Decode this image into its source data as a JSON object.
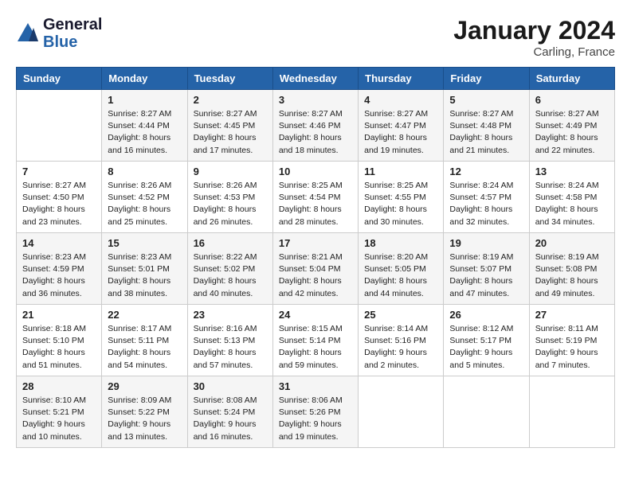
{
  "logo": {
    "line1": "General",
    "line2": "Blue"
  },
  "header": {
    "month": "January 2024",
    "location": "Carling, France"
  },
  "weekdays": [
    "Sunday",
    "Monday",
    "Tuesday",
    "Wednesday",
    "Thursday",
    "Friday",
    "Saturday"
  ],
  "weeks": [
    [
      {
        "day": "",
        "sunrise": "",
        "sunset": "",
        "daylight": ""
      },
      {
        "day": "1",
        "sunrise": "Sunrise: 8:27 AM",
        "sunset": "Sunset: 4:44 PM",
        "daylight": "Daylight: 8 hours and 16 minutes."
      },
      {
        "day": "2",
        "sunrise": "Sunrise: 8:27 AM",
        "sunset": "Sunset: 4:45 PM",
        "daylight": "Daylight: 8 hours and 17 minutes."
      },
      {
        "day": "3",
        "sunrise": "Sunrise: 8:27 AM",
        "sunset": "Sunset: 4:46 PM",
        "daylight": "Daylight: 8 hours and 18 minutes."
      },
      {
        "day": "4",
        "sunrise": "Sunrise: 8:27 AM",
        "sunset": "Sunset: 4:47 PM",
        "daylight": "Daylight: 8 hours and 19 minutes."
      },
      {
        "day": "5",
        "sunrise": "Sunrise: 8:27 AM",
        "sunset": "Sunset: 4:48 PM",
        "daylight": "Daylight: 8 hours and 21 minutes."
      },
      {
        "day": "6",
        "sunrise": "Sunrise: 8:27 AM",
        "sunset": "Sunset: 4:49 PM",
        "daylight": "Daylight: 8 hours and 22 minutes."
      }
    ],
    [
      {
        "day": "7",
        "sunrise": "Sunrise: 8:27 AM",
        "sunset": "Sunset: 4:50 PM",
        "daylight": "Daylight: 8 hours and 23 minutes."
      },
      {
        "day": "8",
        "sunrise": "Sunrise: 8:26 AM",
        "sunset": "Sunset: 4:52 PM",
        "daylight": "Daylight: 8 hours and 25 minutes."
      },
      {
        "day": "9",
        "sunrise": "Sunrise: 8:26 AM",
        "sunset": "Sunset: 4:53 PM",
        "daylight": "Daylight: 8 hours and 26 minutes."
      },
      {
        "day": "10",
        "sunrise": "Sunrise: 8:25 AM",
        "sunset": "Sunset: 4:54 PM",
        "daylight": "Daylight: 8 hours and 28 minutes."
      },
      {
        "day": "11",
        "sunrise": "Sunrise: 8:25 AM",
        "sunset": "Sunset: 4:55 PM",
        "daylight": "Daylight: 8 hours and 30 minutes."
      },
      {
        "day": "12",
        "sunrise": "Sunrise: 8:24 AM",
        "sunset": "Sunset: 4:57 PM",
        "daylight": "Daylight: 8 hours and 32 minutes."
      },
      {
        "day": "13",
        "sunrise": "Sunrise: 8:24 AM",
        "sunset": "Sunset: 4:58 PM",
        "daylight": "Daylight: 8 hours and 34 minutes."
      }
    ],
    [
      {
        "day": "14",
        "sunrise": "Sunrise: 8:23 AM",
        "sunset": "Sunset: 4:59 PM",
        "daylight": "Daylight: 8 hours and 36 minutes."
      },
      {
        "day": "15",
        "sunrise": "Sunrise: 8:23 AM",
        "sunset": "Sunset: 5:01 PM",
        "daylight": "Daylight: 8 hours and 38 minutes."
      },
      {
        "day": "16",
        "sunrise": "Sunrise: 8:22 AM",
        "sunset": "Sunset: 5:02 PM",
        "daylight": "Daylight: 8 hours and 40 minutes."
      },
      {
        "day": "17",
        "sunrise": "Sunrise: 8:21 AM",
        "sunset": "Sunset: 5:04 PM",
        "daylight": "Daylight: 8 hours and 42 minutes."
      },
      {
        "day": "18",
        "sunrise": "Sunrise: 8:20 AM",
        "sunset": "Sunset: 5:05 PM",
        "daylight": "Daylight: 8 hours and 44 minutes."
      },
      {
        "day": "19",
        "sunrise": "Sunrise: 8:19 AM",
        "sunset": "Sunset: 5:07 PM",
        "daylight": "Daylight: 8 hours and 47 minutes."
      },
      {
        "day": "20",
        "sunrise": "Sunrise: 8:19 AM",
        "sunset": "Sunset: 5:08 PM",
        "daylight": "Daylight: 8 hours and 49 minutes."
      }
    ],
    [
      {
        "day": "21",
        "sunrise": "Sunrise: 8:18 AM",
        "sunset": "Sunset: 5:10 PM",
        "daylight": "Daylight: 8 hours and 51 minutes."
      },
      {
        "day": "22",
        "sunrise": "Sunrise: 8:17 AM",
        "sunset": "Sunset: 5:11 PM",
        "daylight": "Daylight: 8 hours and 54 minutes."
      },
      {
        "day": "23",
        "sunrise": "Sunrise: 8:16 AM",
        "sunset": "Sunset: 5:13 PM",
        "daylight": "Daylight: 8 hours and 57 minutes."
      },
      {
        "day": "24",
        "sunrise": "Sunrise: 8:15 AM",
        "sunset": "Sunset: 5:14 PM",
        "daylight": "Daylight: 8 hours and 59 minutes."
      },
      {
        "day": "25",
        "sunrise": "Sunrise: 8:14 AM",
        "sunset": "Sunset: 5:16 PM",
        "daylight": "Daylight: 9 hours and 2 minutes."
      },
      {
        "day": "26",
        "sunrise": "Sunrise: 8:12 AM",
        "sunset": "Sunset: 5:17 PM",
        "daylight": "Daylight: 9 hours and 5 minutes."
      },
      {
        "day": "27",
        "sunrise": "Sunrise: 8:11 AM",
        "sunset": "Sunset: 5:19 PM",
        "daylight": "Daylight: 9 hours and 7 minutes."
      }
    ],
    [
      {
        "day": "28",
        "sunrise": "Sunrise: 8:10 AM",
        "sunset": "Sunset: 5:21 PM",
        "daylight": "Daylight: 9 hours and 10 minutes."
      },
      {
        "day": "29",
        "sunrise": "Sunrise: 8:09 AM",
        "sunset": "Sunset: 5:22 PM",
        "daylight": "Daylight: 9 hours and 13 minutes."
      },
      {
        "day": "30",
        "sunrise": "Sunrise: 8:08 AM",
        "sunset": "Sunset: 5:24 PM",
        "daylight": "Daylight: 9 hours and 16 minutes."
      },
      {
        "day": "31",
        "sunrise": "Sunrise: 8:06 AM",
        "sunset": "Sunset: 5:26 PM",
        "daylight": "Daylight: 9 hours and 19 minutes."
      },
      {
        "day": "",
        "sunrise": "",
        "sunset": "",
        "daylight": ""
      },
      {
        "day": "",
        "sunrise": "",
        "sunset": "",
        "daylight": ""
      },
      {
        "day": "",
        "sunrise": "",
        "sunset": "",
        "daylight": ""
      }
    ]
  ]
}
